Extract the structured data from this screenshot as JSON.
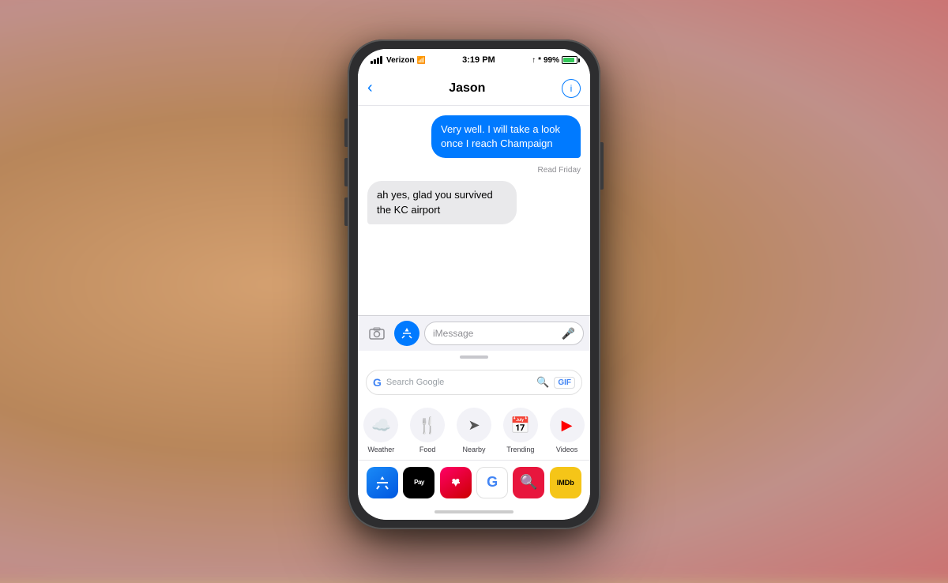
{
  "background": {
    "description": "blurred warm background with hand holding phone"
  },
  "statusBar": {
    "carrier": "Verizon",
    "time": "3:19 PM",
    "battery": "99%"
  },
  "navBar": {
    "backLabel": "‹",
    "contactName": "Jason",
    "infoIcon": "ⓘ"
  },
  "messages": [
    {
      "type": "sent",
      "text": "Very well. I will take a look once I reach Champaign",
      "receipt": "Read Friday"
    },
    {
      "type": "received",
      "text": "ah yes, glad you survived the KC airport"
    }
  ],
  "inputBar": {
    "cameraIcon": "📷",
    "appstoreIcon": "A",
    "placeholder": "iMessage",
    "micIcon": "🎤"
  },
  "googleSearch": {
    "placeholder": "Search Google",
    "gifLabel": "GIF"
  },
  "suggestions": [
    {
      "label": "Weather",
      "icon": "☁️"
    },
    {
      "label": "Food",
      "icon": "🍴"
    },
    {
      "label": "Nearby",
      "icon": "➤"
    },
    {
      "label": "Trending",
      "icon": "📅"
    },
    {
      "label": "Videos",
      "icon": "▶"
    }
  ],
  "dock": [
    {
      "label": "App Store",
      "type": "appstore"
    },
    {
      "label": "Apple Pay",
      "type": "applepay"
    },
    {
      "label": "Heart App",
      "type": "heart"
    },
    {
      "label": "Google",
      "type": "google"
    },
    {
      "label": "Search",
      "type": "search"
    },
    {
      "label": "IMDb",
      "type": "imdb"
    }
  ]
}
